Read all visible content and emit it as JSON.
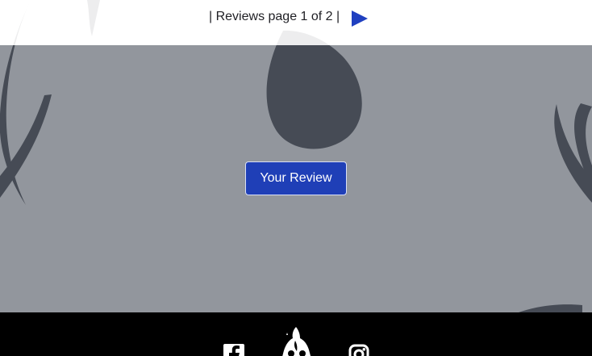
{
  "pager": {
    "text": "| Reviews page 1 of 2 |",
    "next_icon": "triangle-right-icon"
  },
  "actions": {
    "your_review": "Your Review"
  },
  "footer": {
    "icons": [
      "facebook-icon",
      "ghost-logo",
      "instagram-icon"
    ]
  },
  "colors": {
    "primary_button": "#1f3fb7",
    "overlay": "#7c818b",
    "footer": "#000000",
    "next_arrow": "#2040c0"
  }
}
